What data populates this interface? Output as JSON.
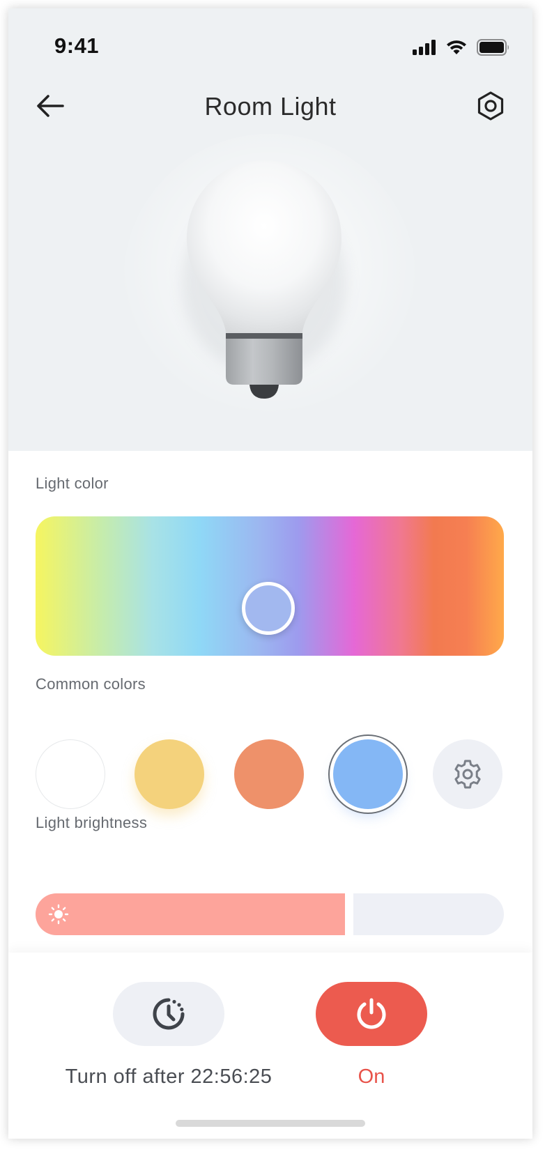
{
  "status_bar": {
    "time": "9:41",
    "icons": [
      "signal-icon",
      "wifi-icon",
      "battery-icon"
    ]
  },
  "header": {
    "title": "Room Light",
    "back_icon": "arrow-left-icon",
    "settings_icon": "hexagon-settings-icon"
  },
  "light_color": {
    "label": "Light color",
    "selected_color": "#a2b8ef",
    "gradient_colors": [
      "#f6f560",
      "#c6ecab",
      "#a8e2e6",
      "#8fd8f6",
      "#9cb6f0",
      "#9d9bee",
      "#e568d6",
      "#f07890",
      "#f27a50",
      "#ffa94a"
    ]
  },
  "common_colors": {
    "label": "Common colors",
    "swatches": [
      {
        "name": "white",
        "color": "#ffffff",
        "selected": false
      },
      {
        "name": "yellow",
        "color": "#f4d27c",
        "selected": false
      },
      {
        "name": "orange",
        "color": "#ee916a",
        "selected": false
      },
      {
        "name": "blue",
        "color": "#84b7f5",
        "selected": true
      },
      {
        "name": "custom",
        "icon": "gear-icon",
        "selected": false
      }
    ]
  },
  "brightness": {
    "label": "Light brightness",
    "value_fraction": 0.67,
    "fill_color": "#fda49b",
    "icon": "sun-icon"
  },
  "footer": {
    "timer_label": "Turn off after 22:56:25",
    "timer_icon": "clock-timer-icon",
    "power_label": "On",
    "power_icon": "power-icon",
    "power_color": "#ec5b4f"
  }
}
